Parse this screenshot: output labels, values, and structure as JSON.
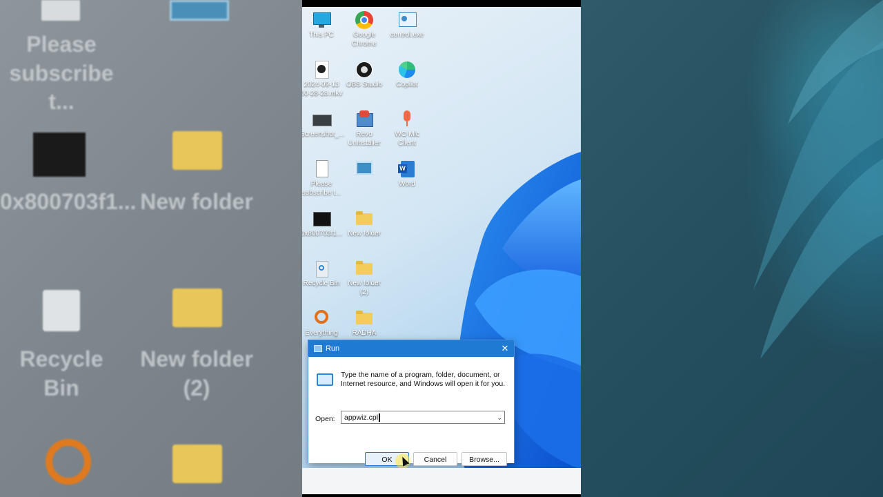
{
  "left_backdrop": {
    "items": [
      {
        "label": "Please\nsubscribe t..."
      },
      {
        "label": "0x800703f1..."
      },
      {
        "label": "New folder"
      },
      {
        "label": "Recycle Bin"
      },
      {
        "label": "New folder\n(2)"
      }
    ]
  },
  "desktop": {
    "icons": [
      {
        "label": "This PC",
        "icon": "monitor-icon"
      },
      {
        "label": "Google\nChrome",
        "icon": "chrome-icon"
      },
      {
        "label": "control.exe",
        "icon": "control-panel-icon"
      },
      {
        "label": "2024-09-13\n00-28-28.mkv",
        "icon": "video-file-icon"
      },
      {
        "label": "OBS Studio",
        "icon": "obs-icon"
      },
      {
        "label": "Copilot",
        "icon": "copilot-icon"
      },
      {
        "label": "Screenshot_...",
        "icon": "screenshot-icon"
      },
      {
        "label": "Revo\nUninstaller",
        "icon": "revo-icon"
      },
      {
        "label": "WO Mic\nClient",
        "icon": "microphone-icon"
      },
      {
        "label": "Please\nsubscribe t...",
        "icon": "text-file-icon"
      },
      {
        "label": "",
        "icon": "control-panel-icon"
      },
      {
        "label": "Word",
        "icon": "word-icon"
      },
      {
        "label": "0x800703f1...",
        "icon": "black-image-icon"
      },
      {
        "label": "New folder",
        "icon": "folder-icon"
      },
      {
        "label": "Recycle Bin",
        "icon": "recycle-bin-icon"
      },
      {
        "label": "New folder\n(2)",
        "icon": "folder-icon"
      },
      {
        "label": "Everything",
        "icon": "everything-icon"
      },
      {
        "label": "RADHA",
        "icon": "folder-icon"
      }
    ]
  },
  "run_dialog": {
    "title": "Run",
    "close_glyph": "✕",
    "description": "Type the name of a program, folder, document, or Internet resource, and Windows will open it for you.",
    "open_label": "Open:",
    "open_value": "appwiz.cpl",
    "ok_label": "OK",
    "cancel_label": "Cancel",
    "browse_label": "Browse..."
  },
  "colors": {
    "accent": "#1f7ad3",
    "dialog_bg": "#ffffff"
  }
}
